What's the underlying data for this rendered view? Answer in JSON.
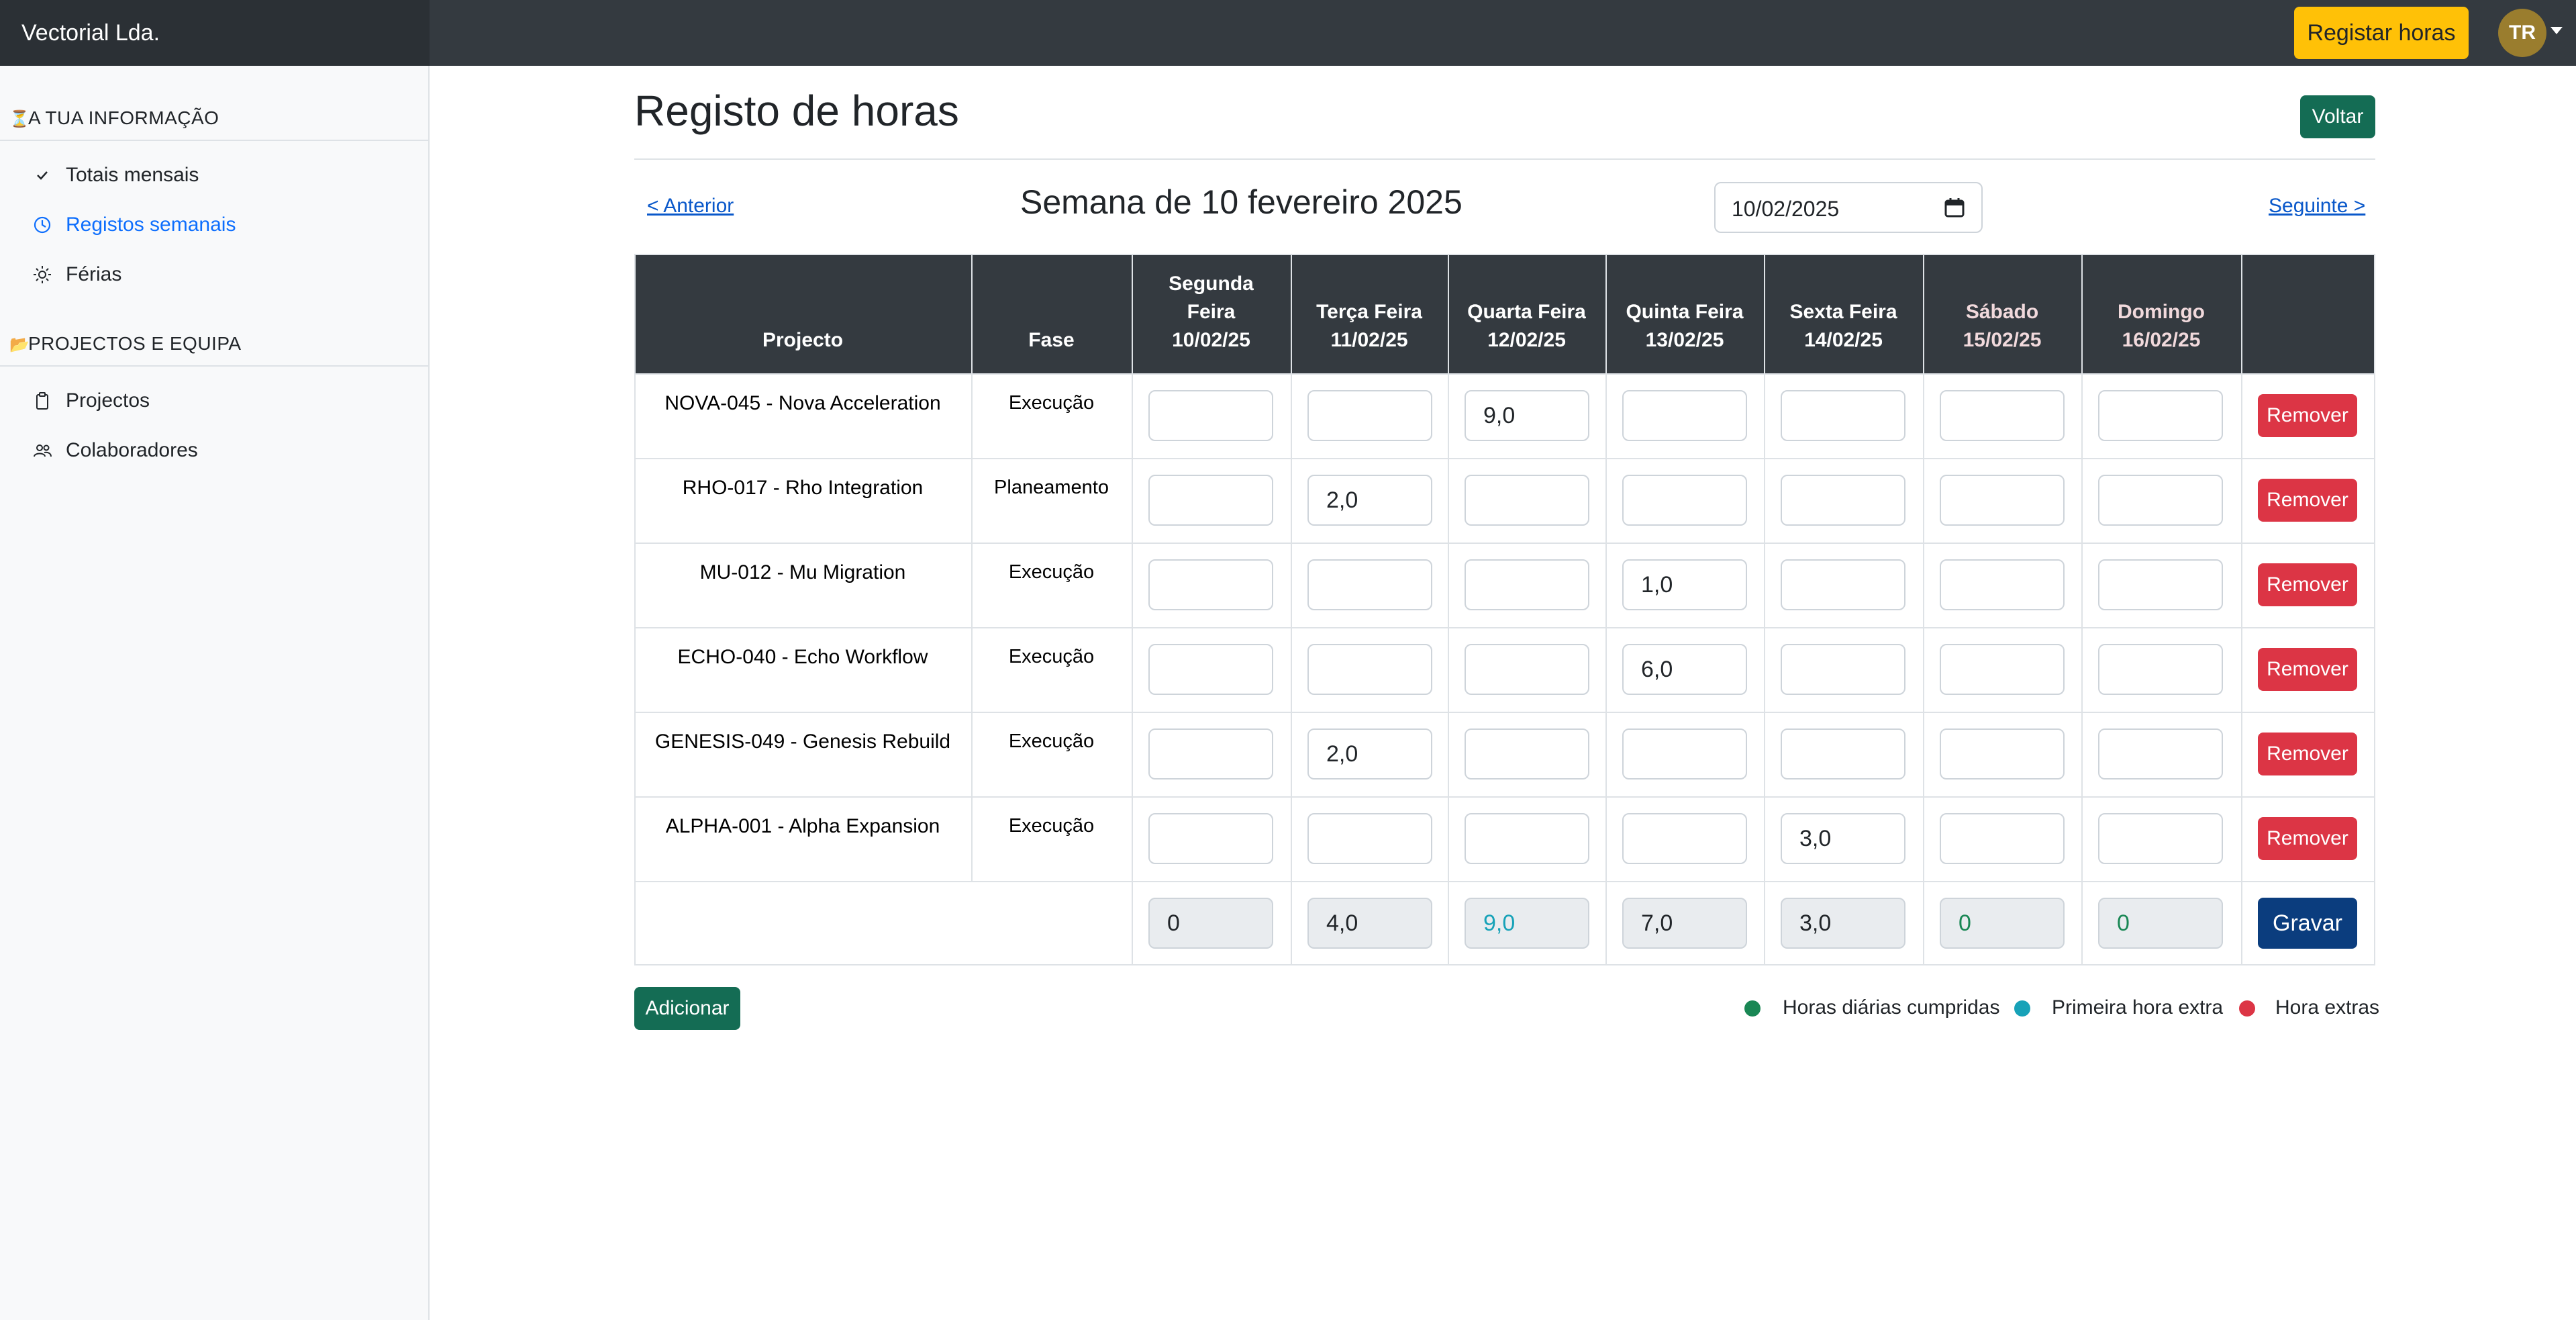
{
  "header": {
    "brand": "Vectorial Lda.",
    "register_button": "Registar horas",
    "avatar_initials": "TR",
    "accent_color": "#ffc107"
  },
  "sidebar": {
    "section1": {
      "icon": "hourglass-icon",
      "label": "A TUA INFORMAÇÃO"
    },
    "items1": [
      {
        "icon": "check-icon",
        "label": "Totais mensais",
        "active": false
      },
      {
        "icon": "clock-icon",
        "label": "Registos semanais",
        "active": true
      },
      {
        "icon": "sun-icon",
        "label": "Férias",
        "active": false
      }
    ],
    "section2": {
      "icon": "folder-icon",
      "label": "PROJECTOS E EQUIPA"
    },
    "items2": [
      {
        "icon": "clipboard-icon",
        "label": "Projectos",
        "active": false
      },
      {
        "icon": "people-icon",
        "label": "Colaboradores",
        "active": false
      }
    ]
  },
  "page": {
    "title": "Registo de horas",
    "back_button": "Voltar",
    "prev_link": "< Anterior",
    "next_link": "Seguinte >",
    "week_label": "Semana de 10 fevereiro 2025",
    "date_value": "10/02/2025"
  },
  "table": {
    "col_project": "Projecto",
    "col_phase": "Fase",
    "days": [
      {
        "name_line1": "Segunda",
        "name_line2": "Feira",
        "date": "10/02/25",
        "weekend": false
      },
      {
        "name_line1": "",
        "name_line2": "Terça Feira",
        "date": "11/02/25",
        "weekend": false
      },
      {
        "name_line1": "",
        "name_line2": "Quarta Feira",
        "date": "12/02/25",
        "weekend": false
      },
      {
        "name_line1": "",
        "name_line2": "Quinta Feira",
        "date": "13/02/25",
        "weekend": false
      },
      {
        "name_line1": "",
        "name_line2": "Sexta Feira",
        "date": "14/02/25",
        "weekend": false
      },
      {
        "name_line1": "",
        "name_line2": "Sábado",
        "date": "15/02/25",
        "weekend": true
      },
      {
        "name_line1": "",
        "name_line2": "Domingo",
        "date": "16/02/25",
        "weekend": true
      }
    ],
    "rows": [
      {
        "project": "NOVA-045 - Nova Acceleration",
        "phase": "Execução",
        "hours": [
          "",
          "",
          "9,0",
          "",
          "",
          "",
          ""
        ],
        "remove": "Remover"
      },
      {
        "project": "RHO-017 - Rho Integration",
        "phase": "Planeamento",
        "hours": [
          "",
          "2,0",
          "",
          "",
          "",
          "",
          ""
        ],
        "remove": "Remover"
      },
      {
        "project": "MU-012 - Mu Migration",
        "phase": "Execução",
        "hours": [
          "",
          "",
          "",
          "1,0",
          "",
          "",
          ""
        ],
        "remove": "Remover"
      },
      {
        "project": "ECHO-040 - Echo Workflow",
        "phase": "Execução",
        "hours": [
          "",
          "",
          "",
          "6,0",
          "",
          "",
          ""
        ],
        "remove": "Remover"
      },
      {
        "project": "GENESIS-049 - Genesis Rebuild",
        "phase": "Execução",
        "hours": [
          "",
          "2,0",
          "",
          "",
          "",
          "",
          ""
        ],
        "remove": "Remover"
      },
      {
        "project": "ALPHA-001 - Alpha Expansion",
        "phase": "Execução",
        "hours": [
          "",
          "",
          "",
          "",
          "3,0",
          "",
          ""
        ],
        "remove": "Remover"
      }
    ],
    "totals": [
      {
        "value": "0",
        "status": "normal"
      },
      {
        "value": "4,0",
        "status": "normal"
      },
      {
        "value": "9,0",
        "status": "first-extra"
      },
      {
        "value": "7,0",
        "status": "normal"
      },
      {
        "value": "3,0",
        "status": "normal"
      },
      {
        "value": "0",
        "status": "fulfilled"
      },
      {
        "value": "0",
        "status": "fulfilled"
      }
    ],
    "save_button": "Gravar"
  },
  "footer": {
    "add_button": "Adicionar",
    "legend": [
      {
        "label": "Horas diárias cumpridas",
        "color": "#198754"
      },
      {
        "label": "Primeira hora extra",
        "color": "#17a2b8"
      },
      {
        "label": "Hora extras",
        "color": "#dc3545"
      }
    ]
  },
  "status_colors": {
    "normal": "#212529",
    "fulfilled": "#198754",
    "first-extra": "#17a2b8",
    "extra": "#dc3545"
  }
}
